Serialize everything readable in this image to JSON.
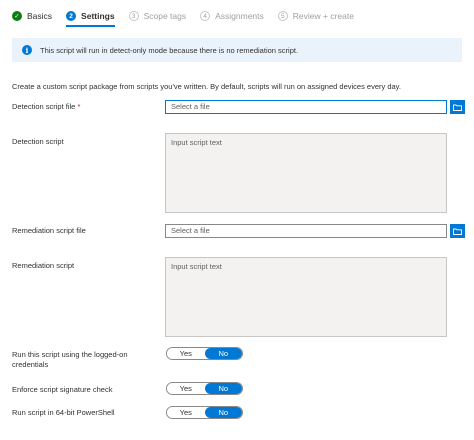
{
  "wizard": {
    "steps": [
      {
        "number": "✓",
        "label": "Basics",
        "state": "done"
      },
      {
        "number": "2",
        "label": "Settings",
        "state": "current"
      },
      {
        "number": "3",
        "label": "Scope tags",
        "state": "future"
      },
      {
        "number": "4",
        "label": "Assignments",
        "state": "future"
      },
      {
        "number": "5",
        "label": "Review + create",
        "state": "future"
      }
    ]
  },
  "banner": {
    "icon": "info-icon",
    "icon_glyph": "i",
    "text": "This script will run in detect-only mode because there is no remediation script."
  },
  "description": "Create a custom script package from scripts you've written. By default, scripts will run on assigned devices every day.",
  "detection_file": {
    "label": "Detection script file",
    "required_marker": "*",
    "placeholder": "Select a file"
  },
  "detection_script": {
    "label": "Detection script",
    "placeholder": "Input script text"
  },
  "remediation_file": {
    "label": "Remediation script file",
    "placeholder": "Select a file"
  },
  "remediation_script": {
    "label": "Remediation script",
    "placeholder": "Input script text"
  },
  "toggles": {
    "logged_on": {
      "label": "Run this script using the logged-on credentials",
      "yes": "Yes",
      "no": "No",
      "selected": "No"
    },
    "signature": {
      "label": "Enforce script signature check",
      "yes": "Yes",
      "no": "No",
      "selected": "No"
    },
    "powershell64": {
      "label": "Run script in 64-bit PowerShell",
      "yes": "Yes",
      "no": "No",
      "selected": "No"
    }
  },
  "colors": {
    "accent": "#0078d4",
    "done": "#107c10",
    "banner_bg": "#eaf3fc",
    "required": "#a4262c"
  }
}
